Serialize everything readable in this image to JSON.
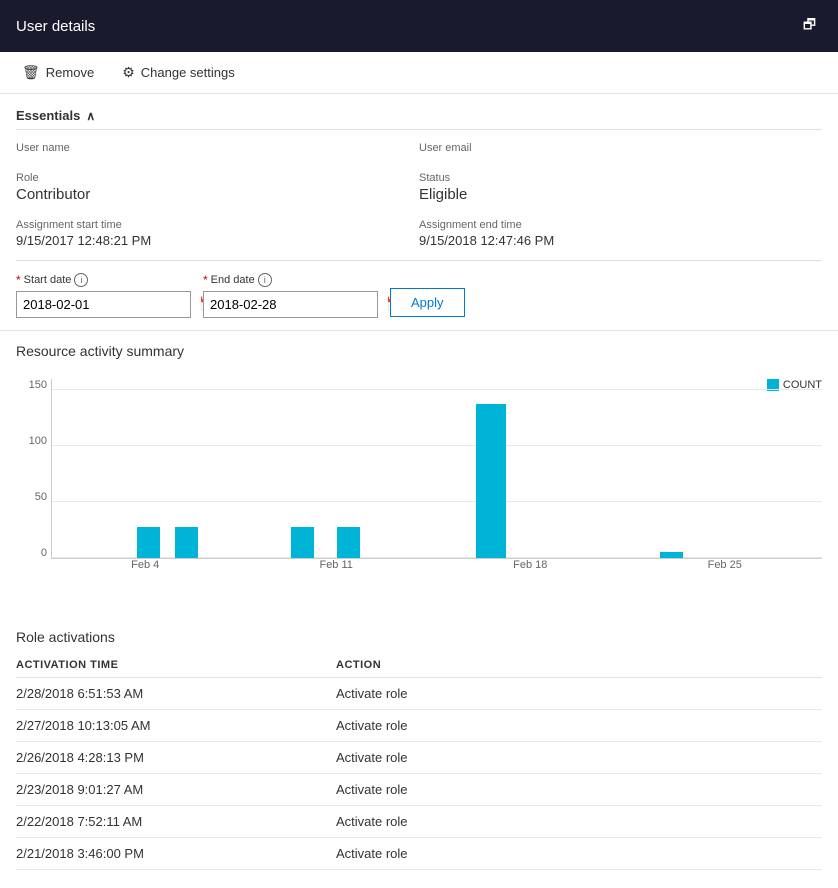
{
  "titleBar": {
    "title": "User details",
    "controls": {
      "restore": "🗗"
    }
  },
  "toolbar": {
    "removeLabel": "Remove",
    "removeIcon": "🗑",
    "changeSettingsLabel": "Change settings",
    "settingsIcon": "⚙"
  },
  "essentials": {
    "label": "Essentials",
    "chevron": "∧",
    "fields": {
      "userNameLabel": "User name",
      "userNameValue": "",
      "userEmailLabel": "User email",
      "userEmailValue": "",
      "roleLabel": "Role",
      "roleValue": "Contributor",
      "statusLabel": "Status",
      "statusValue": "Eligible",
      "assignmentStartLabel": "Assignment start time",
      "assignmentStartValue": "9/15/2017 12:48:21 PM",
      "assignmentEndLabel": "Assignment end time",
      "assignmentEndValue": "9/15/2018 12:47:46 PM"
    }
  },
  "dateFilter": {
    "startDateLabel": "Start date",
    "startDateValue": "2018-02-01",
    "startDatePlaceholder": "2018-02-01",
    "endDateLabel": "End date",
    "endDateValue": "2018-02-28",
    "endDatePlaceholder": "2018-02-28",
    "applyLabel": "Apply",
    "infoIcon": "i"
  },
  "chart": {
    "title": "Resource activity summary",
    "legendLabel": "COUNT",
    "yAxisLabels": [
      "150",
      "100",
      "50",
      "0"
    ],
    "xAxisLabels": [
      "Feb 4",
      "Feb 11",
      "Feb 18",
      "Feb 25"
    ],
    "bars": [
      {
        "x": 9,
        "height": 17,
        "label": "Feb 4 bar1"
      },
      {
        "x": 17,
        "height": 17,
        "label": "Feb 4 bar2"
      },
      {
        "x": 32,
        "height": 17,
        "label": "Feb 11 bar1"
      },
      {
        "x": 40,
        "height": 17,
        "label": "Feb 11 bar2"
      },
      {
        "x": 62,
        "height": 91,
        "label": "Feb 18 bar"
      },
      {
        "x": 88,
        "height": 3,
        "label": "Feb 25 bar"
      }
    ],
    "barColor": "#00b4d8",
    "maxValue": 160
  },
  "roleActivations": {
    "title": "Role activations",
    "columns": [
      {
        "id": "activationTime",
        "label": "ACTIVATION TIME"
      },
      {
        "id": "action",
        "label": "ACTION"
      }
    ],
    "rows": [
      {
        "activationTime": "2/28/2018 6:51:53 AM",
        "action": "Activate role"
      },
      {
        "activationTime": "2/27/2018 10:13:05 AM",
        "action": "Activate role"
      },
      {
        "activationTime": "2/26/2018 4:28:13 PM",
        "action": "Activate role"
      },
      {
        "activationTime": "2/23/2018 9:01:27 AM",
        "action": "Activate role"
      },
      {
        "activationTime": "2/22/2018 7:52:11 AM",
        "action": "Activate role"
      },
      {
        "activationTime": "2/21/2018 3:46:00 PM",
        "action": "Activate role"
      }
    ]
  }
}
